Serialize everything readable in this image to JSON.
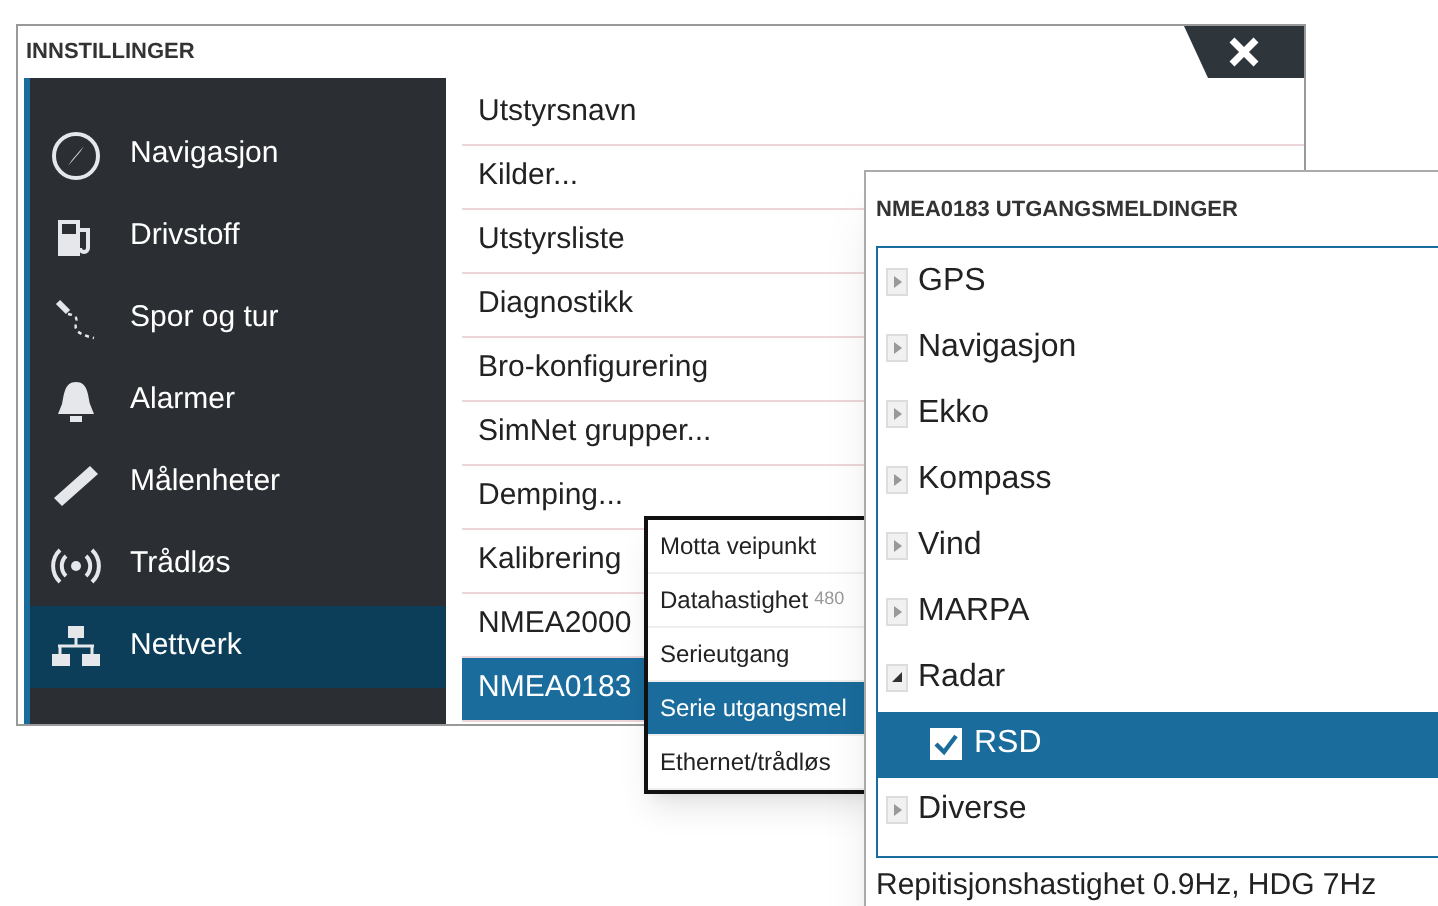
{
  "window": {
    "title": "INNSTILLINGER"
  },
  "sidebar": {
    "items": [
      {
        "label": "Navigasjon",
        "kind": "compass",
        "selected": false
      },
      {
        "label": "Drivstoff",
        "kind": "fuel",
        "selected": false
      },
      {
        "label": "Spor og tur",
        "kind": "trail",
        "selected": false
      },
      {
        "label": "Alarmer",
        "kind": "bell",
        "selected": false
      },
      {
        "label": "Målenheter",
        "kind": "ruler",
        "selected": false
      },
      {
        "label": "Trådløs",
        "kind": "wireless",
        "selected": false
      },
      {
        "label": "Nettverk",
        "kind": "network",
        "selected": true
      }
    ]
  },
  "network_list": {
    "items": [
      {
        "label": "Utstyrsnavn",
        "selected": false
      },
      {
        "label": "Kilder...",
        "selected": false
      },
      {
        "label": "Utstyrsliste",
        "selected": false
      },
      {
        "label": "Diagnostikk",
        "selected": false
      },
      {
        "label": "Bro-konfigurering",
        "selected": false
      },
      {
        "label": "SimNet grupper...",
        "selected": false
      },
      {
        "label": "Demping...",
        "selected": false
      },
      {
        "label": "Kalibrering",
        "selected": false
      },
      {
        "label": "NMEA2000",
        "selected": false
      },
      {
        "label": "NMEA0183",
        "selected": true
      }
    ]
  },
  "nmea_menu": {
    "items": [
      {
        "label": "Motta veipunkt",
        "selected": false
      },
      {
        "label": "Datahastighet",
        "value": "480",
        "selected": false
      },
      {
        "label": "Serieutgang",
        "selected": false
      },
      {
        "label": "Serie utgangsmel",
        "selected": true
      },
      {
        "label": "Ethernet/trådløs",
        "selected": false
      }
    ]
  },
  "dialog": {
    "title": "NMEA0183 UTGANGSMELDINGER",
    "tree": [
      {
        "label": "GPS",
        "expanded": false,
        "selected": false
      },
      {
        "label": "Navigasjon",
        "expanded": false,
        "selected": false
      },
      {
        "label": "Ekko",
        "expanded": false,
        "selected": false
      },
      {
        "label": "Kompass",
        "expanded": false,
        "selected": false
      },
      {
        "label": "Vind",
        "expanded": false,
        "selected": false
      },
      {
        "label": "MARPA",
        "expanded": false,
        "selected": false
      },
      {
        "label": "Radar",
        "expanded": true,
        "selected": false,
        "children": [
          {
            "label": "RSD",
            "checked": true,
            "selected": true
          }
        ]
      },
      {
        "label": "Diverse",
        "expanded": false,
        "selected": false
      }
    ],
    "footer": "Repitisjonshastighet 0.9Hz, HDG 7Hz"
  }
}
